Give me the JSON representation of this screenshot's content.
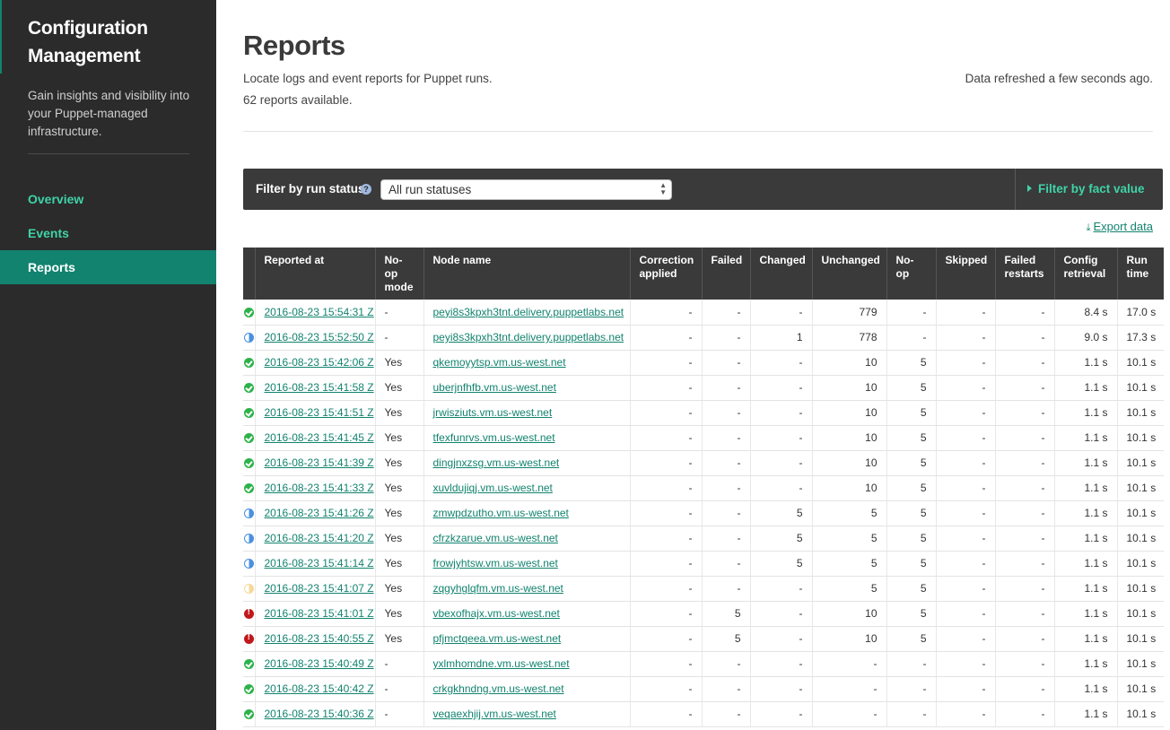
{
  "sidebar": {
    "title": "Configuration Management",
    "tagline": "Gain insights and visibility into your Puppet-managed infrastructure.",
    "nav": [
      {
        "label": "Overview"
      },
      {
        "label": "Events"
      },
      {
        "label": "Reports"
      }
    ]
  },
  "header": {
    "title": "Reports",
    "subtitle": "Locate logs and event reports for Puppet runs.",
    "count": "62 reports available.",
    "refreshed": "Data refreshed a few seconds ago."
  },
  "filters": {
    "run_status_label": "Filter by run status",
    "run_status_value": "All run statuses",
    "fact_filter_label": "Filter by fact value"
  },
  "export_label": "Export data",
  "table": {
    "columns": [
      "Reported at",
      "No-op mode",
      "Node name",
      "Correction applied",
      "Failed",
      "Changed",
      "Unchanged",
      "No-op",
      "Skipped",
      "Failed restarts",
      "Config retrieval",
      "Run time"
    ],
    "rows": [
      {
        "status": "ok",
        "reported": "2016-08-23 15:54:31 Z",
        "noop_mode": "-",
        "node": "peyi8s3kpxh3tnt.delivery.puppetlabs.net",
        "correction": "-",
        "failed": "-",
        "changed": "-",
        "unchanged": "779",
        "noop": "-",
        "skipped": "-",
        "failed_restarts": "-",
        "config": "8.4 s",
        "run_time": "17.0 s"
      },
      {
        "status": "changed",
        "reported": "2016-08-23 15:52:50 Z",
        "noop_mode": "-",
        "node": "peyi8s3kpxh3tnt.delivery.puppetlabs.net",
        "correction": "-",
        "failed": "-",
        "changed": "1",
        "unchanged": "778",
        "noop": "-",
        "skipped": "-",
        "failed_restarts": "-",
        "config": "9.0 s",
        "run_time": "17.3 s"
      },
      {
        "status": "ok",
        "reported": "2016-08-23 15:42:06 Z",
        "noop_mode": "Yes",
        "node": "qkemoyytsp.vm.us-west.net",
        "correction": "-",
        "failed": "-",
        "changed": "-",
        "unchanged": "10",
        "noop": "5",
        "skipped": "-",
        "failed_restarts": "-",
        "config": "1.1 s",
        "run_time": "10.1 s"
      },
      {
        "status": "ok",
        "reported": "2016-08-23 15:41:58 Z",
        "noop_mode": "Yes",
        "node": "uberjnfhfb.vm.us-west.net",
        "correction": "-",
        "failed": "-",
        "changed": "-",
        "unchanged": "10",
        "noop": "5",
        "skipped": "-",
        "failed_restarts": "-",
        "config": "1.1 s",
        "run_time": "10.1 s"
      },
      {
        "status": "ok",
        "reported": "2016-08-23 15:41:51 Z",
        "noop_mode": "Yes",
        "node": "jrwisziuts.vm.us-west.net",
        "correction": "-",
        "failed": "-",
        "changed": "-",
        "unchanged": "10",
        "noop": "5",
        "skipped": "-",
        "failed_restarts": "-",
        "config": "1.1 s",
        "run_time": "10.1 s"
      },
      {
        "status": "ok",
        "reported": "2016-08-23 15:41:45 Z",
        "noop_mode": "Yes",
        "node": "tfexfunrvs.vm.us-west.net",
        "correction": "-",
        "failed": "-",
        "changed": "-",
        "unchanged": "10",
        "noop": "5",
        "skipped": "-",
        "failed_restarts": "-",
        "config": "1.1 s",
        "run_time": "10.1 s"
      },
      {
        "status": "ok",
        "reported": "2016-08-23 15:41:39 Z",
        "noop_mode": "Yes",
        "node": "dingjnxzsg.vm.us-west.net",
        "correction": "-",
        "failed": "-",
        "changed": "-",
        "unchanged": "10",
        "noop": "5",
        "skipped": "-",
        "failed_restarts": "-",
        "config": "1.1 s",
        "run_time": "10.1 s"
      },
      {
        "status": "ok",
        "reported": "2016-08-23 15:41:33 Z",
        "noop_mode": "Yes",
        "node": "xuvldujiqj.vm.us-west.net",
        "correction": "-",
        "failed": "-",
        "changed": "-",
        "unchanged": "10",
        "noop": "5",
        "skipped": "-",
        "failed_restarts": "-",
        "config": "1.1 s",
        "run_time": "10.1 s"
      },
      {
        "status": "changed",
        "reported": "2016-08-23 15:41:26 Z",
        "noop_mode": "Yes",
        "node": "zmwpdzutho.vm.us-west.net",
        "correction": "-",
        "failed": "-",
        "changed": "5",
        "unchanged": "5",
        "noop": "5",
        "skipped": "-",
        "failed_restarts": "-",
        "config": "1.1 s",
        "run_time": "10.1 s"
      },
      {
        "status": "changed",
        "reported": "2016-08-23 15:41:20 Z",
        "noop_mode": "Yes",
        "node": "cfrzkzarue.vm.us-west.net",
        "correction": "-",
        "failed": "-",
        "changed": "5",
        "unchanged": "5",
        "noop": "5",
        "skipped": "-",
        "failed_restarts": "-",
        "config": "1.1 s",
        "run_time": "10.1 s"
      },
      {
        "status": "changed",
        "reported": "2016-08-23 15:41:14 Z",
        "noop_mode": "Yes",
        "node": "frowjyhtsw.vm.us-west.net",
        "correction": "-",
        "failed": "-",
        "changed": "5",
        "unchanged": "5",
        "noop": "5",
        "skipped": "-",
        "failed_restarts": "-",
        "config": "1.1 s",
        "run_time": "10.1 s"
      },
      {
        "status": "noop",
        "reported": "2016-08-23 15:41:07 Z",
        "noop_mode": "Yes",
        "node": "zqgyhglqfm.vm.us-west.net",
        "correction": "-",
        "failed": "-",
        "changed": "-",
        "unchanged": "5",
        "noop": "5",
        "skipped": "-",
        "failed_restarts": "-",
        "config": "1.1 s",
        "run_time": "10.1 s"
      },
      {
        "status": "failed",
        "reported": "2016-08-23 15:41:01 Z",
        "noop_mode": "Yes",
        "node": "vbexofhajx.vm.us-west.net",
        "correction": "-",
        "failed": "5",
        "changed": "-",
        "unchanged": "10",
        "noop": "5",
        "skipped": "-",
        "failed_restarts": "-",
        "config": "1.1 s",
        "run_time": "10.1 s"
      },
      {
        "status": "failed",
        "reported": "2016-08-23 15:40:55 Z",
        "noop_mode": "Yes",
        "node": "pfjmctqeea.vm.us-west.net",
        "correction": "-",
        "failed": "5",
        "changed": "-",
        "unchanged": "10",
        "noop": "5",
        "skipped": "-",
        "failed_restarts": "-",
        "config": "1.1 s",
        "run_time": "10.1 s"
      },
      {
        "status": "ok",
        "reported": "2016-08-23 15:40:49 Z",
        "noop_mode": "-",
        "node": "yxlmhomdne.vm.us-west.net",
        "correction": "-",
        "failed": "-",
        "changed": "-",
        "unchanged": "-",
        "noop": "-",
        "skipped": "-",
        "failed_restarts": "-",
        "config": "1.1 s",
        "run_time": "10.1 s"
      },
      {
        "status": "ok",
        "reported": "2016-08-23 15:40:42 Z",
        "noop_mode": "-",
        "node": "crkgkhndng.vm.us-west.net",
        "correction": "-",
        "failed": "-",
        "changed": "-",
        "unchanged": "-",
        "noop": "-",
        "skipped": "-",
        "failed_restarts": "-",
        "config": "1.1 s",
        "run_time": "10.1 s"
      },
      {
        "status": "ok",
        "reported": "2016-08-23 15:40:36 Z",
        "noop_mode": "-",
        "node": "veqaexhjij.vm.us-west.net",
        "correction": "-",
        "failed": "-",
        "changed": "-",
        "unchanged": "-",
        "noop": "-",
        "skipped": "-",
        "failed_restarts": "-",
        "config": "1.1 s",
        "run_time": "10.1 s"
      }
    ]
  }
}
